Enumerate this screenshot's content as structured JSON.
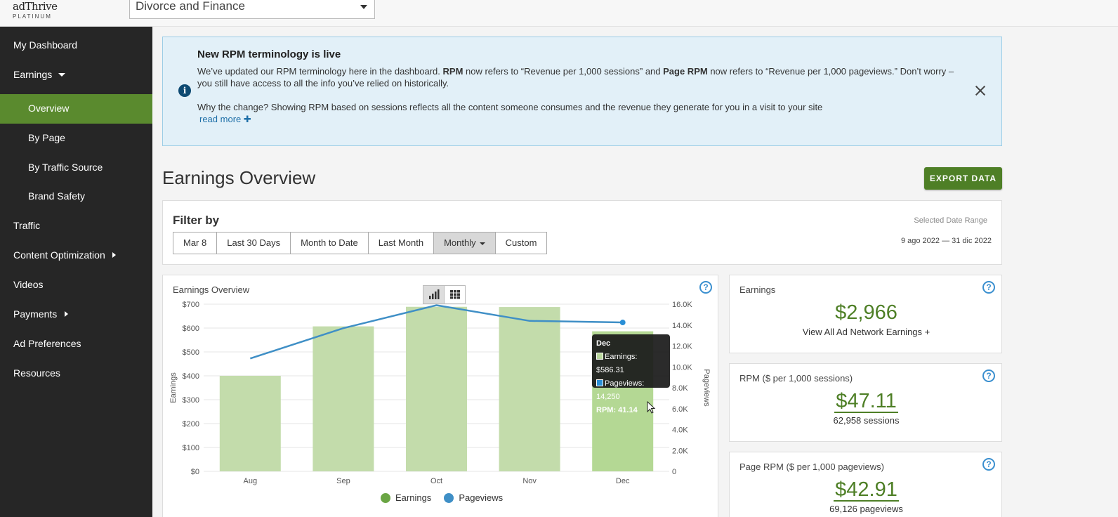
{
  "header": {
    "logo_line1": "adThrive",
    "logo_line2": "PLATINUM",
    "site_select": "Divorce and Finance"
  },
  "sidebar": {
    "items": [
      {
        "label": "My Dashboard"
      },
      {
        "label": "Earnings"
      },
      {
        "label": "Overview"
      },
      {
        "label": "By Page"
      },
      {
        "label": "By Traffic Source"
      },
      {
        "label": "Brand Safety"
      },
      {
        "label": "Traffic"
      },
      {
        "label": "Content Optimization"
      },
      {
        "label": "Videos"
      },
      {
        "label": "Payments"
      },
      {
        "label": "Ad Preferences"
      },
      {
        "label": "Resources"
      }
    ]
  },
  "notice": {
    "title": "New RPM terminology is live",
    "p1_a": "We’ve updated our RPM terminology here in the dashboard. ",
    "p1_b": "RPM",
    "p1_c": " now refers to “Revenue per 1,000 sessions” and ",
    "p1_d": "Page RPM",
    "p1_e": " now refers to “Revenue per 1,000 pageviews.” Don’t worry – you still have access to all the info you’ve relied on historically.",
    "p2": "Why the change? Showing RPM based on sessions reflects all the content someone consumes and the revenue they generate for you in a visit to your site",
    "read_more": "read more ✚"
  },
  "page": {
    "title": "Earnings Overview",
    "export_label": "EXPORT DATA"
  },
  "filter": {
    "title": "Filter by",
    "buttons": [
      "Mar 8",
      "Last 30 Days",
      "Month to Date",
      "Last Month",
      "Monthly",
      "Custom"
    ],
    "range_label": "Selected Date Range",
    "range_value": "9 ago 2022 — 31 dic 2022"
  },
  "chart_panel": {
    "title": "Earnings Overview",
    "legend": [
      "Earnings",
      "Pageviews"
    ],
    "tooltip": {
      "month": "Dec",
      "earnings": "Earnings: $586.31",
      "pageviews": "Pageviews: 14,250",
      "rpm": "RPM: 41.14"
    }
  },
  "colors": {
    "accent_green": "#4e7f26",
    "bar_green": "#b9d79c",
    "line_blue": "#3f8fc6",
    "sidebar_active": "#5a8a2e"
  },
  "chart_data": {
    "type": "bar",
    "categories": [
      "Aug",
      "Sep",
      "Oct",
      "Nov",
      "Dec"
    ],
    "series": [
      {
        "name": "Earnings",
        "axis": "left",
        "values": [
          400,
          607,
          689,
          688,
          586.31
        ]
      },
      {
        "name": "Pageviews",
        "axis": "right",
        "type": "line",
        "values": [
          10800,
          13700,
          15900,
          14400,
          14250
        ]
      }
    ],
    "ylabel": "Earnings",
    "y2label": "Pageviews",
    "ylim": [
      0,
      700
    ],
    "y2lim": [
      0,
      16000
    ],
    "yticks": [
      "$0",
      "$100",
      "$200",
      "$300",
      "$400",
      "$500",
      "$600",
      "$700"
    ],
    "y2ticks": [
      "0",
      "2.0K",
      "4.0K",
      "6.0K",
      "8.0K",
      "10.0K",
      "12.0K",
      "14.0K",
      "16.0K"
    ],
    "grid": true,
    "legend_position": "bottom"
  },
  "cards": {
    "earnings": {
      "title": "Earnings",
      "value": "$2,966",
      "link": "View All Ad Network Earnings +"
    },
    "rpm": {
      "title": "RPM ($ per 1,000 sessions)",
      "value": "$47.11",
      "sub": "62,958 sessions"
    },
    "page_rpm": {
      "title": "Page RPM ($ per 1,000 pageviews)",
      "value": "$42.91",
      "sub": "69,126 pageviews"
    }
  }
}
